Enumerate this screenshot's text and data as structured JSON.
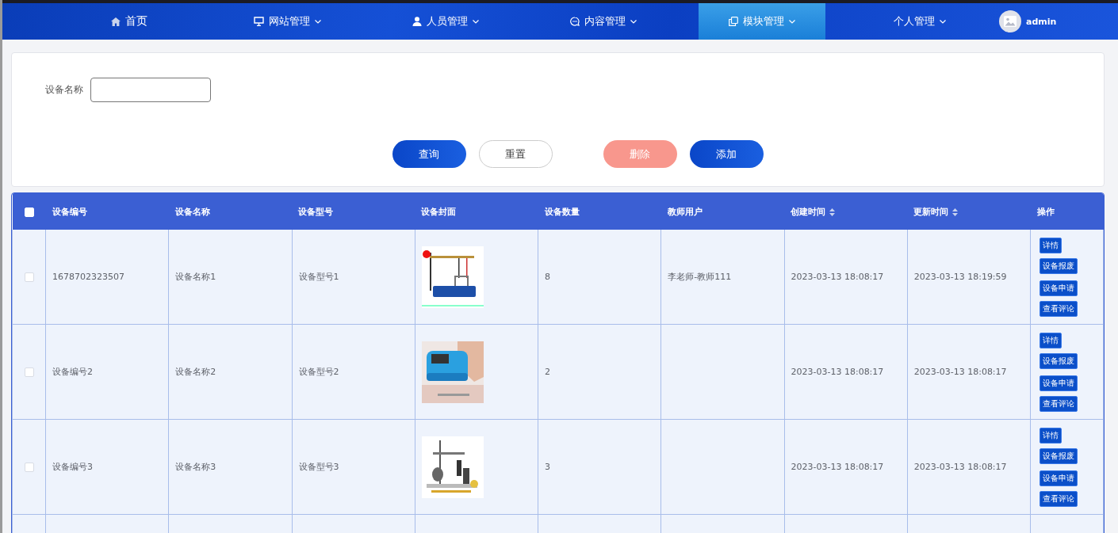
{
  "nav": {
    "items": [
      {
        "label": "首页",
        "selected": false,
        "dropdown": false
      },
      {
        "label": "网站管理",
        "selected": false,
        "dropdown": true
      },
      {
        "label": "人员管理",
        "selected": false,
        "dropdown": true
      },
      {
        "label": "内容管理",
        "selected": false,
        "dropdown": true
      },
      {
        "label": "模块管理",
        "selected": true,
        "dropdown": true
      },
      {
        "label": "个人管理",
        "selected": false,
        "dropdown": true
      }
    ],
    "user": "admin"
  },
  "search": {
    "label": "设备名称",
    "buttons": [
      {
        "label": "查询",
        "kind": "primary"
      },
      {
        "label": "重置",
        "kind": "plain"
      },
      {
        "label": "删除",
        "kind": "danger"
      },
      {
        "label": "添加",
        "kind": "primary"
      }
    ]
  },
  "table": {
    "select_all": {
      "checked": false
    },
    "columns": [
      {
        "label": "设备编号",
        "sortable": false
      },
      {
        "label": "设备名称",
        "sortable": false
      },
      {
        "label": "设备型号",
        "sortable": false
      },
      {
        "label": "设备封面",
        "sortable": false
      },
      {
        "label": "设备数量",
        "sortable": false
      },
      {
        "label": "教师用户",
        "sortable": false
      },
      {
        "label": "创建时间",
        "sortable": true
      },
      {
        "label": "更新时间",
        "sortable": true
      },
      {
        "label": "操作",
        "sortable": false
      }
    ],
    "rows": [
      {
        "checked": false,
        "cells": [
          "1678702323507",
          "设备名称1",
          "设备型号1",
          {
            "kind": "picture"
          },
          "8",
          "李老师-教师111",
          "2023-03-13 18:08:17",
          "2023-03-13 18:19:59"
        ],
        "actions": [
          "详情",
          "设备报废",
          "设备申请",
          "查看评论"
        ]
      },
      {
        "checked": false,
        "cells": [
          "设备编号2",
          "设备名称2",
          "设备型号2",
          {
            "kind": "picture"
          },
          "2",
          "",
          "2023-03-13 18:08:17",
          "2023-03-13 18:08:17"
        ],
        "actions": [
          "详情",
          "设备报废",
          "设备申请",
          "查看评论"
        ]
      },
      {
        "checked": false,
        "cells": [
          "设备编号3",
          "设备名称3",
          "设备型号3",
          {
            "kind": "picture"
          },
          "3",
          "",
          "2023-03-13 18:08:17",
          "2023-03-13 18:08:17"
        ],
        "actions": [
          "详情",
          "设备报废",
          "设备申请",
          "查看评论"
        ]
      }
    ]
  }
}
